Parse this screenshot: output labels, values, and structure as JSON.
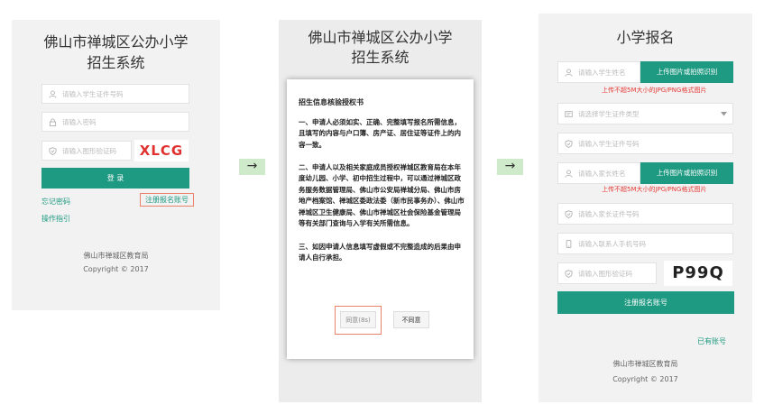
{
  "arrow": "→",
  "panel1": {
    "title_line1": "佛山市禅城区公办小学",
    "title_line2": "招生系统",
    "id_placeholder": "请输入学生证件号码",
    "password_placeholder": "请输入密码",
    "captcha_placeholder": "请输入图形验证码",
    "captcha_text": "XLCG",
    "login_label": "登 录",
    "forgot_password": "忘记密码",
    "register_link": "注册报名账号",
    "guide_link": "操作指引",
    "footer_org": "佛山市禅城区教育局",
    "footer_copyright": "Copyright © 2017"
  },
  "panel2": {
    "title_line1": "佛山市禅城区公办小学",
    "title_line2": "招生系统",
    "modal": {
      "heading": "招生信息核验授权书",
      "para1": "一、申请人必须如实、正确、完整填写报名所需信息，且填写的内容与户口簿、房产证、居住证等证件上的内容一致。",
      "para2": "二、申请人以及相关家庭成员授权禅城区教育局在本年度幼儿园、小学、初中招生过程中，可以通过禅城区政务服务数据管理局、佛山市公安局禅城分局、佛山市房地产档案馆、禅城区委政法委（新市民事务办）、佛山市禅城区卫生健康局、佛山市禅城区社会保险基金管理局等有关部门查询与入学有关所需信息。",
      "para3": "三、如因申请人信息填写虚假或不完整造成的后果由申请人自行承担。",
      "agree_label": "同意(8s)",
      "disagree_label": "不同意"
    }
  },
  "panel3": {
    "title": "小学报名",
    "student_name_placeholder": "请输入学生姓名",
    "upload_label": "上传图片或拍照识别",
    "upload_hint": "上传不超5M大小的JPG/PNG格式图片",
    "doc_type_placeholder": "请选择学生证件类型",
    "student_id_placeholder": "请输入学生证件号码",
    "parent_name_placeholder": "请输入家长姓名",
    "parent_upload_label": "上传图片或拍照识别",
    "parent_upload_hint": "上传不超5M大小的JPG/PNG格式图片",
    "parent_id_placeholder": "请输入家长证件号码",
    "phone_placeholder": "请输入联系人手机号码",
    "captcha_placeholder": "请输入图形验证码",
    "captcha_text": "P99Q",
    "register_label": "注册报名账号",
    "have_account": "已有账号",
    "footer_org": "佛山市禅城区教育局",
    "footer_copyright": "Copyright © 2017"
  },
  "colors": {
    "accent": "#1e9a82",
    "error": "#e53935",
    "highlight": "#e8826a",
    "arrow_bg": "#cfeacb"
  },
  "icons": [
    "user-icon",
    "lock-icon",
    "shield-icon",
    "card-icon",
    "phone-icon",
    "chevron-down-icon",
    "arrow-right-icon"
  ]
}
